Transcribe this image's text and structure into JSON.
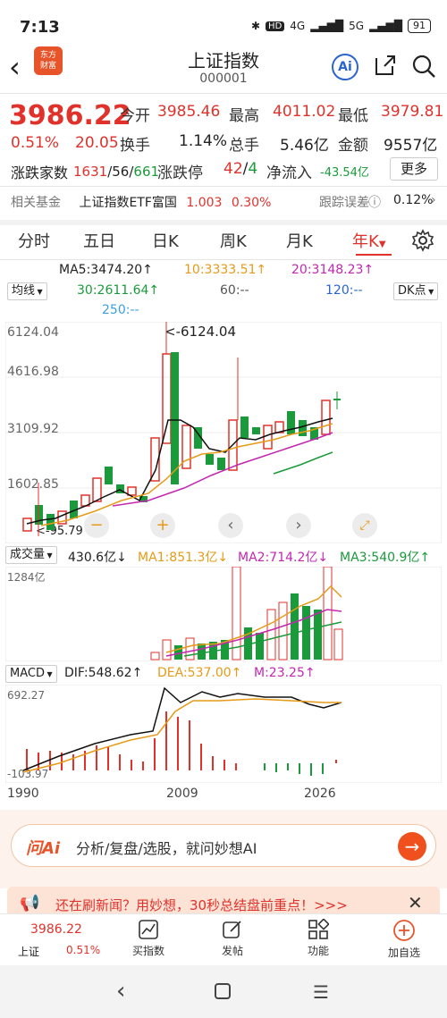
{
  "status": {
    "time": "7:13",
    "network": "4G",
    "network2": "5G",
    "battery": "91",
    "hd": "HD"
  },
  "header": {
    "title": "上证指数",
    "code": "000001",
    "logo_line1": "东方",
    "logo_line2": "财富",
    "ai_label": "Ai"
  },
  "quote": {
    "price": "3986.22",
    "change_pct": "0.51%",
    "change_val": "20.05",
    "open_label": "今开",
    "open": "3985.46",
    "high_label": "最高",
    "high": "4011.02",
    "low_label": "最低",
    "low": "3979.81",
    "turnover_label": "换手",
    "turnover": "1.14%",
    "volume_label": "总手",
    "volume": "5.46亿",
    "amount_label": "金额",
    "amount": "9557亿",
    "updown_label": "涨跌家数",
    "up": "1631",
    "flat": "56",
    "down": "661",
    "limit_label": "涨跌停",
    "limit_up": "42",
    "limit_down": "4",
    "netflow_label": "净流入",
    "netflow": "-43.54亿",
    "more": "更多"
  },
  "fund": {
    "label": "相关基金",
    "name": "上证指数ETF富国",
    "price": "1.003",
    "pct": "0.30%",
    "track_label": "跟踪误差",
    "track_val": "0.12%"
  },
  "tabs": [
    "分时",
    "五日",
    "日K",
    "周K",
    "月K",
    "年K"
  ],
  "active_tab": "年K",
  "ma_legend": {
    "ma5": "MA5:3474.20↑",
    "ma10": "10:3333.51↑",
    "ma20": "20:3148.23↑",
    "selector": "均线",
    "ma30": "30:2611.64↑",
    "ma60": "60:--",
    "ma120": "120:--",
    "dk": "DK点",
    "ma250": "250:--"
  },
  "kline": {
    "y_labels": [
      "6124.04",
      "4616.98",
      "3109.92",
      "1602.85",
      "95.79"
    ],
    "max_note": "<-6124.04",
    "min_note": "<-95.79"
  },
  "volume_panel": {
    "selector": "成交量",
    "vol": "430.6亿↓",
    "ma1": "MA1:851.3亿↓",
    "ma2": "MA2:714.2亿↓",
    "ma3": "MA3:540.9亿↑",
    "y_top": "1284亿"
  },
  "macd_panel": {
    "selector": "MACD",
    "dif": "DIF:548.62↑",
    "dea": "DEA:537.00↑",
    "m": "M:23.25↑",
    "y_top": "692.27",
    "y_bottom": "-103.97"
  },
  "x_axis": [
    "1990",
    "2009",
    "2026"
  ],
  "ai_bar": {
    "logo": "问Ai",
    "text": "分析/复盘/选股，就问妙想AI"
  },
  "news": {
    "text": "还在刷新闻？用妙想，30秒总结盘前重点！>>>"
  },
  "bottom_nav": {
    "mini_price": "3986.22",
    "mini_name": "上证",
    "mini_pct": "0.51%",
    "items": [
      "买指数",
      "发帖",
      "功能",
      "加自选"
    ]
  },
  "colors": {
    "up": "#e0322b",
    "down": "#1a9a3a",
    "ma5": "#111111",
    "ma10": "#e69a17",
    "ma20": "#c327b0",
    "ma30": "#1a9a3a"
  }
}
